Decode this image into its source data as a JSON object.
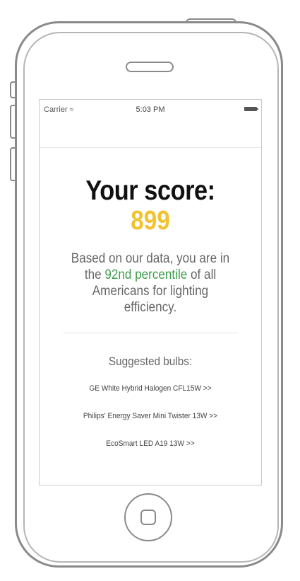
{
  "status_bar": {
    "carrier": "Carrier",
    "wifi_icon": "wifi-icon",
    "time": "5:03 PM",
    "battery_icon": "battery-icon"
  },
  "score": {
    "title": "Your score:",
    "value": "899",
    "value_color": "#f2c230"
  },
  "percentile": {
    "prefix": "Based on our data, you are in the ",
    "highlight": "92nd percentile",
    "suffix": " of all Americans for lighting efficiency.",
    "highlight_color": "#3e9e4a"
  },
  "suggestions": {
    "title": "Suggested bulbs:",
    "items": [
      {
        "label": "GE White Hybrid Halogen CFL15W >>"
      },
      {
        "label": "Philips' Energy Saver Mini Twister 13W >>"
      },
      {
        "label": "EcoSmart LED A19 13W >>"
      }
    ]
  }
}
